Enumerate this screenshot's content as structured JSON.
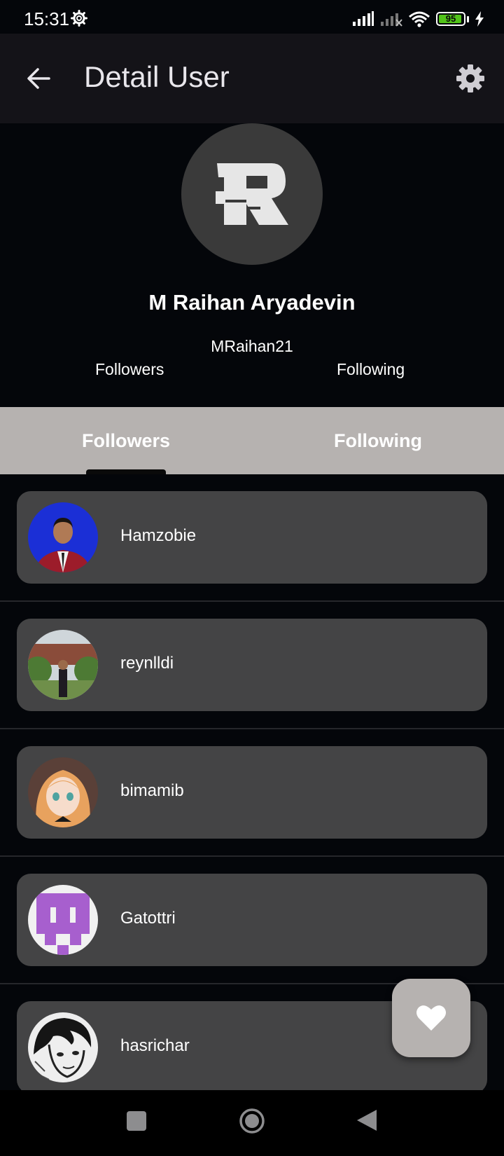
{
  "status_bar": {
    "time": "15:31",
    "battery_level": "95",
    "battery_fraction": 0.95,
    "icons": [
      "settings-gear-icon",
      "signal-icon",
      "signal-off-icon",
      "wifi-icon",
      "battery-icon",
      "charging-bolt-icon"
    ]
  },
  "app_bar": {
    "title": "Detail User",
    "back_icon": "arrow-left-icon",
    "settings_icon": "gear-icon"
  },
  "profile": {
    "avatar_letter": "R",
    "name": "M Raihan Aryadevin",
    "login": "MRaihan21",
    "followers_label": "Followers",
    "following_label": "Following"
  },
  "tabs": [
    {
      "label": "Followers",
      "selected": true
    },
    {
      "label": "Following",
      "selected": false
    }
  ],
  "followers": [
    {
      "name": "Hamzobie",
      "avatar": "photo-red-blazer"
    },
    {
      "name": "reynlldi",
      "avatar": "photo-garden"
    },
    {
      "name": "bimamib",
      "avatar": "anime-girl"
    },
    {
      "name": "Gatottri",
      "avatar": "identicon-purple"
    },
    {
      "name": "hasrichar",
      "avatar": "manga-sketch"
    }
  ],
  "fab": {
    "icon": "heart-icon"
  },
  "nav_bar": {
    "icons": [
      "recents-square-icon",
      "home-circle-icon",
      "back-triangle-icon"
    ]
  },
  "colors": {
    "background": "#04060a",
    "app_bar": "#141318",
    "tab_bar": "#b6b2b0",
    "card": "#444445",
    "fab": "#b6b2b0",
    "battery": "#52c41a"
  }
}
